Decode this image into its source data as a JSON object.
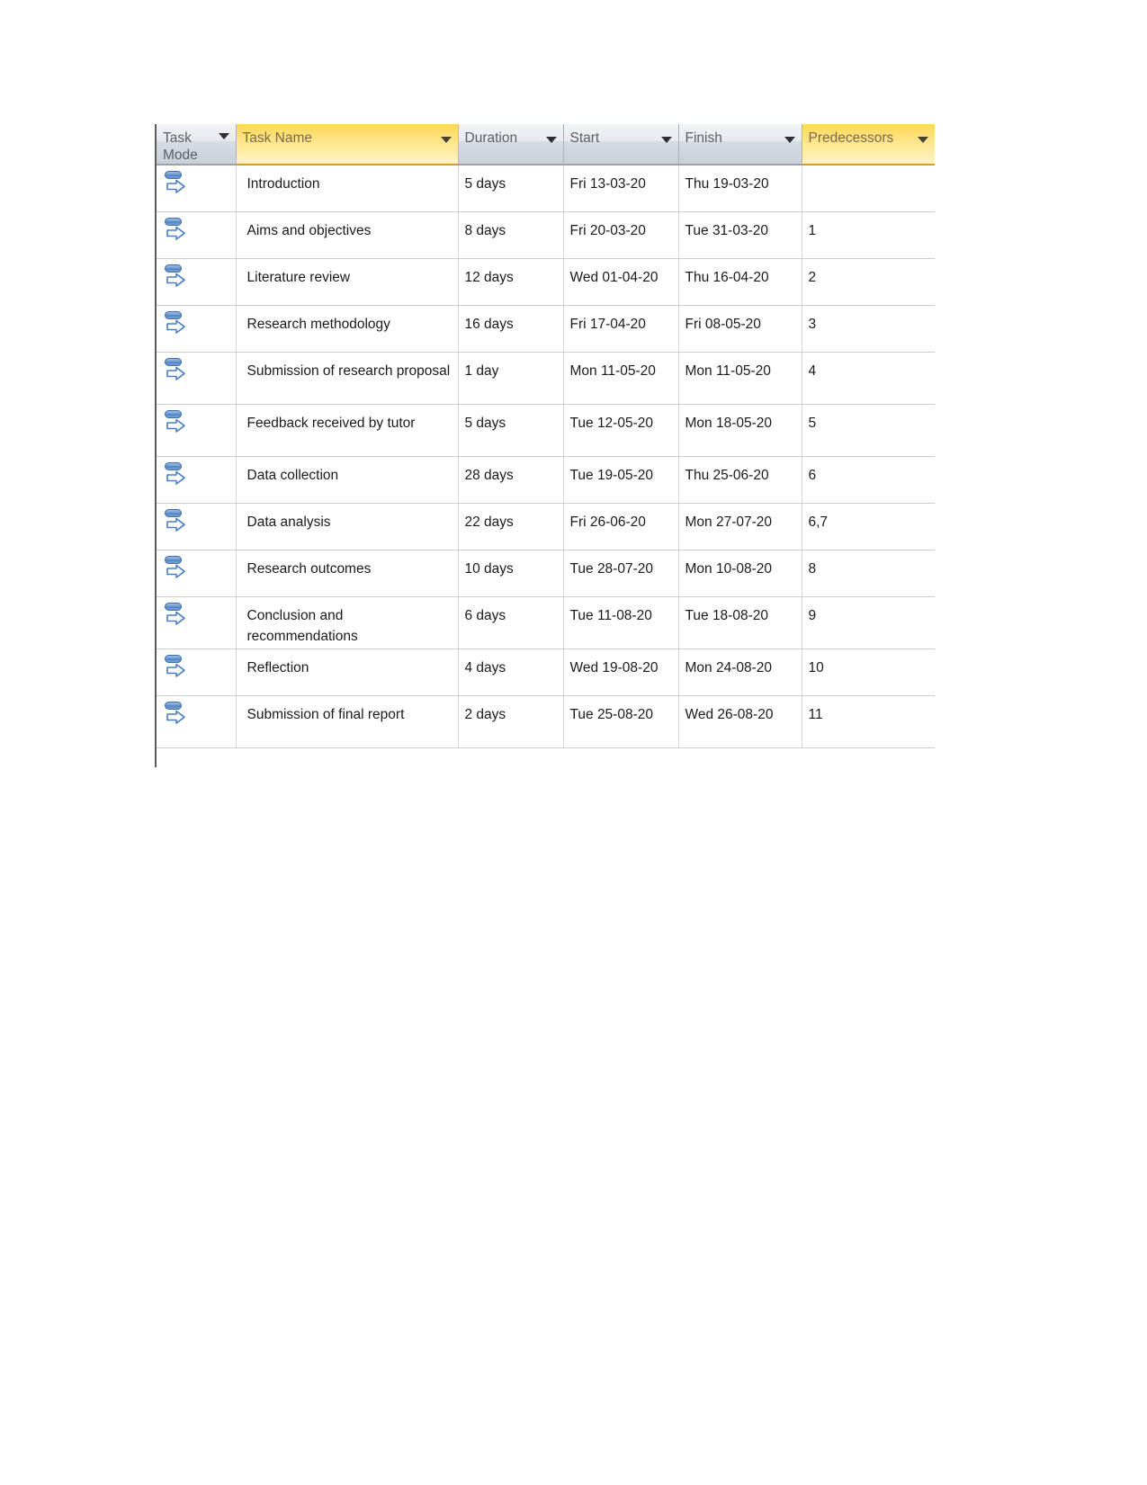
{
  "document": {
    "type": "project-schedule-table",
    "background_color": "#ffffff"
  },
  "table": {
    "name": "project-task-table",
    "highlight_color": "#fed954",
    "header_color": "#d6dce3",
    "grid_line_color": "#c9ced4",
    "columns": [
      {
        "id": "task_mode",
        "label": "Task Mode",
        "highlighted": false,
        "has_filter": true
      },
      {
        "id": "task_name",
        "label": "Task Name",
        "highlighted": true,
        "has_filter": true
      },
      {
        "id": "duration",
        "label": "Duration",
        "highlighted": false,
        "has_filter": true
      },
      {
        "id": "start",
        "label": "Start",
        "highlighted": false,
        "has_filter": true
      },
      {
        "id": "finish",
        "label": "Finish",
        "highlighted": false,
        "has_filter": true
      },
      {
        "id": "predecessors",
        "label": "Predecessors",
        "highlighted": true,
        "has_filter": true
      }
    ],
    "mode_icon_name": "auto-scheduled-icon",
    "rows": [
      {
        "mode": "auto-scheduled",
        "task_name": "Introduction",
        "duration": "5 days",
        "start": "Fri 13-03-20",
        "finish": "Thu 19-03-20",
        "predecessors": ""
      },
      {
        "mode": "auto-scheduled",
        "task_name": "Aims and objectives",
        "duration": "8 days",
        "start": "Fri 20-03-20",
        "finish": "Tue 31-03-20",
        "predecessors": "1"
      },
      {
        "mode": "auto-scheduled",
        "task_name": "Literature review",
        "duration": "12 days",
        "start": "Wed 01-04-20",
        "finish": "Thu 16-04-20",
        "predecessors": "2"
      },
      {
        "mode": "auto-scheduled",
        "task_name": "Research methodology",
        "duration": "16 days",
        "start": "Fri 17-04-20",
        "finish": "Fri 08-05-20",
        "predecessors": "3"
      },
      {
        "mode": "auto-scheduled",
        "task_name": "Submission of research proposal",
        "duration": "1 day",
        "start": "Mon 11-05-20",
        "finish": "Mon 11-05-20",
        "predecessors": "4"
      },
      {
        "mode": "auto-scheduled",
        "task_name": "Feedback received by tutor",
        "duration": "5 days",
        "start": "Tue 12-05-20",
        "finish": "Mon 18-05-20",
        "predecessors": "5"
      },
      {
        "mode": "auto-scheduled",
        "task_name": "Data collection",
        "duration": "28 days",
        "start": "Tue 19-05-20",
        "finish": "Thu 25-06-20",
        "predecessors": "6"
      },
      {
        "mode": "auto-scheduled",
        "task_name": "Data analysis",
        "duration": "22 days",
        "start": "Fri 26-06-20",
        "finish": "Mon 27-07-20",
        "predecessors": "6,7"
      },
      {
        "mode": "auto-scheduled",
        "task_name": "Research outcomes",
        "duration": "10 days",
        "start": "Tue 28-07-20",
        "finish": "Mon 10-08-20",
        "predecessors": "8"
      },
      {
        "mode": "auto-scheduled",
        "task_name": "Conclusion and recommendations",
        "duration": "6 days",
        "start": "Tue 11-08-20",
        "finish": "Tue 18-08-20",
        "predecessors": "9"
      },
      {
        "mode": "auto-scheduled",
        "task_name": "Reflection",
        "duration": "4 days",
        "start": "Wed 19-08-20",
        "finish": "Mon 24-08-20",
        "predecessors": "10"
      },
      {
        "mode": "auto-scheduled",
        "task_name": "Submission of final report",
        "duration": "2 days",
        "start": "Tue 25-08-20",
        "finish": "Wed 26-08-20",
        "predecessors": "11"
      }
    ]
  }
}
